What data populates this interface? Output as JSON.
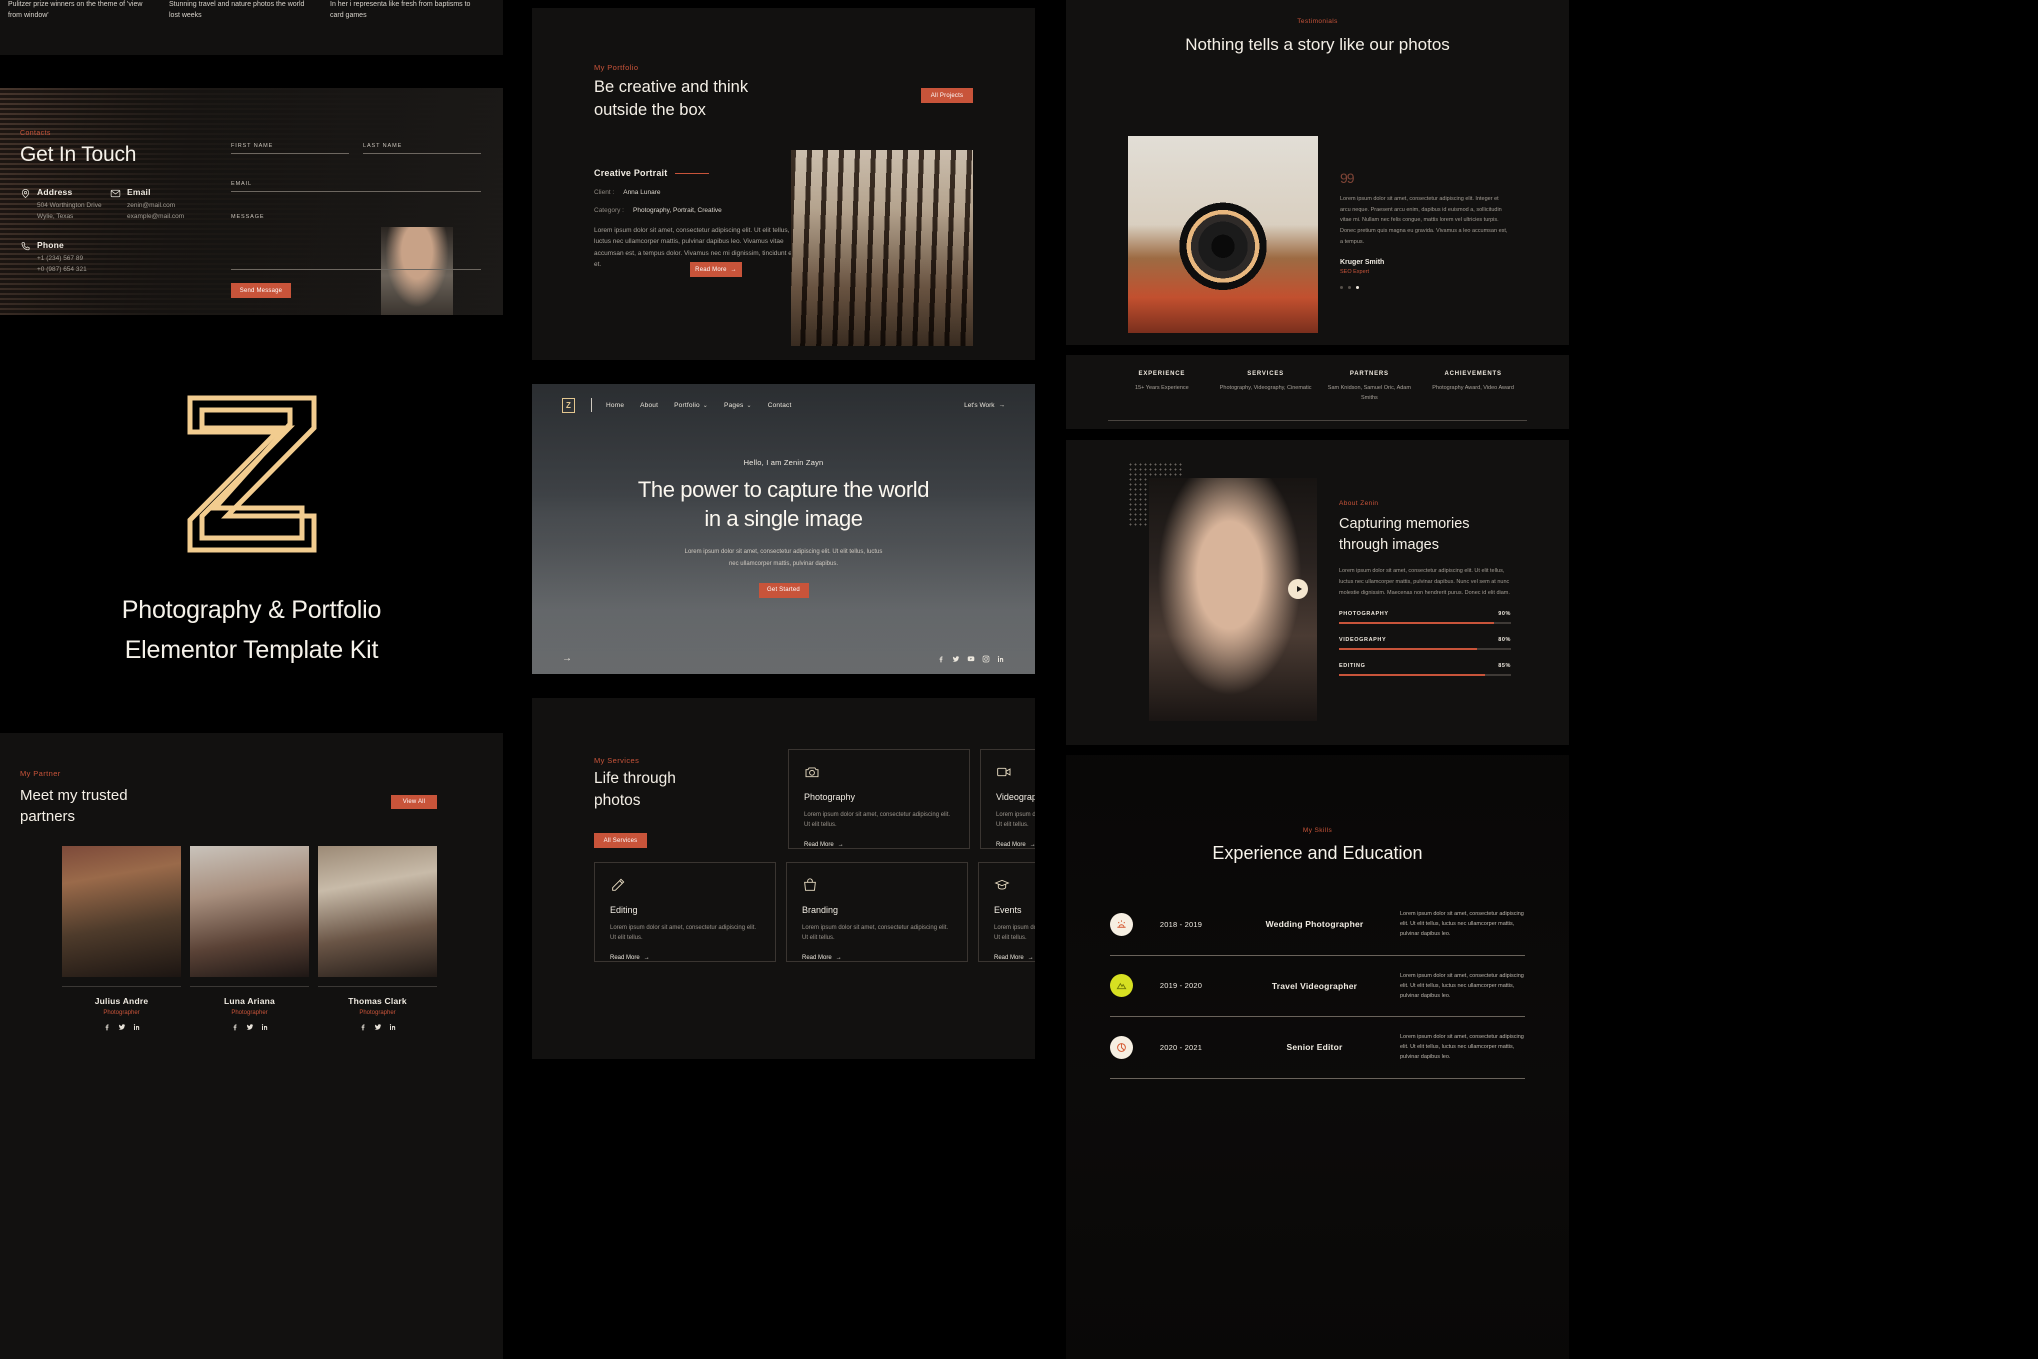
{
  "brand": {
    "logo_letter": "Z",
    "title_line1": "Photography & Portfolio",
    "title_line2": "Elementor Template Kit",
    "accent_gold": "#f2cc8f",
    "accent_red": "#c8543a",
    "panel_bg": "#121110"
  },
  "strip_top": {
    "columns": [
      "Pulitzer prize winners on the theme of 'view from window'",
      "Stunning travel and nature photos the world lost weeks",
      "In her i representa like fresh from baptisms to card games"
    ]
  },
  "contact": {
    "eyebrow": "Contacts",
    "heading": "Get In Touch",
    "blocks": [
      {
        "icon": "map-pin-icon",
        "title": "Address",
        "value": "504 Worthington Drive\nWylie, Texas"
      },
      {
        "icon": "envelope-icon",
        "title": "Email",
        "value": "zenin@mail.com\nexample@mail.com"
      },
      {
        "icon": "phone-icon",
        "title": "Phone",
        "value": "+1 (234) 567 89\n+0 (987) 654 321"
      }
    ],
    "fields": [
      {
        "label": "FIRST NAME",
        "value": ""
      },
      {
        "label": "LAST NAME",
        "value": ""
      },
      {
        "label": "EMAIL",
        "value": ""
      },
      {
        "label": "MESSAGE",
        "value": ""
      }
    ],
    "submit_label": "Send Message"
  },
  "partners": {
    "eyebrow": "My Partner",
    "heading_line1": "Meet my trusted",
    "heading_line2": "partners",
    "view_all_label": "View All",
    "cards": [
      {
        "name": "Julius Andre",
        "role": "Photographer",
        "socials": [
          "facebook-icon",
          "twitter-icon",
          "linkedin-icon"
        ]
      },
      {
        "name": "Luna Ariana",
        "role": "Photographer",
        "socials": [
          "facebook-icon",
          "twitter-icon",
          "linkedin-icon"
        ]
      },
      {
        "name": "Thomas Clark",
        "role": "Photographer",
        "socials": [
          "facebook-icon",
          "twitter-icon",
          "linkedin-icon"
        ]
      }
    ]
  },
  "portfolio": {
    "eyebrow": "My Portfolio",
    "heading_line1": "Be creative and think",
    "heading_line2": "outside the box",
    "all_projects_label": "All Projects",
    "project": {
      "title": "Creative Portrait",
      "client_key": "Client :",
      "client_value": "Anna Lunare",
      "category_key": "Category :",
      "category_value": "Photography, Portrait, Creative",
      "description": "Lorem ipsum dolor sit amet, consectetur adipiscing elit. Ut elit tellus, luctus nec ullamcorper mattis, pulvinar dapibus leo. Vivamus vitae accumsan est, a tempus dolor. Vivamus nec mi dignissim, tincidunt eros et.",
      "read_more_label": "Read More"
    }
  },
  "hero": {
    "logo_letter": "Z",
    "nav": [
      {
        "label": "Home",
        "has_caret": false
      },
      {
        "label": "About",
        "has_caret": false
      },
      {
        "label": "Portfolio",
        "has_caret": true
      },
      {
        "label": "Pages",
        "has_caret": true
      },
      {
        "label": "Contact",
        "has_caret": false
      }
    ],
    "cta_label": "Let's Work",
    "hello": "Hello, I am Zenin Zayn",
    "title_line1": "The power to capture the world",
    "title_line2": "in a single image",
    "subtitle_line1": "Lorem ipsum dolor sit amet, consectetur adipiscing elit. Ut elit tellus, luctus",
    "subtitle_line2": "nec ullamcorper mattis, pulvinar dapibus.",
    "button_label": "Get Started",
    "socials": [
      "facebook-icon",
      "twitter-icon",
      "youtube-icon",
      "instagram-icon",
      "linkedin-icon"
    ]
  },
  "services": {
    "eyebrow": "My Services",
    "heading_line1": "Life through",
    "heading_line2": "photos",
    "all_services_label": "All Services",
    "read_more_label": "Read More",
    "items": [
      {
        "icon": "camera-icon",
        "title": "Photography",
        "desc": "Lorem ipsum dolor sit amet, consectetur adipiscing elit. Ut elit tellus."
      },
      {
        "icon": "video-icon",
        "title": "Videography",
        "desc": "Lorem ipsum dolor sit amet, consectetur adipiscing elit. Ut elit tellus."
      },
      {
        "icon": "pencil-icon",
        "title": "Editing",
        "desc": "Lorem ipsum dolor sit amet, consectetur adipiscing elit. Ut elit tellus."
      },
      {
        "icon": "bag-icon",
        "title": "Branding",
        "desc": "Lorem ipsum dolor sit amet, consectetur adipiscing elit. Ut elit tellus."
      },
      {
        "icon": "graduation-icon",
        "title": "Events",
        "desc": "Lorem ipsum dolor sit amet, consectetur adipiscing elit. Ut elit tellus."
      }
    ]
  },
  "testimonials": {
    "eyebrow": "Testimonials",
    "heading_line1": "Nothing tells a story like our",
    "heading_line2": "photos",
    "quote_mark": "99",
    "quote": "Lorem ipsum dolor sit amet, consectetur adipiscing elit. Integer et arcu neque. Praesent arcu enim, dapibus id euismod a, sollicitudin vitae mi. Nullam nec felis congue, mattis lorem vel ultricies turpis. Donec pretium quis magna eu gravida. Vivamus a leo accumsan est, a tempus.",
    "author": "Kruger Smith",
    "author_role": "SEO Expert",
    "dots": 3,
    "active_dot": 3
  },
  "stats": {
    "cells": [
      {
        "label": "EXPERIENCE",
        "value": "15+ Years Experience"
      },
      {
        "label": "SERVICES",
        "value": "Photography, Videography, Cinematic"
      },
      {
        "label": "PARTNERS",
        "value": "Sam Knidson, Samuel Oric, Adam Smiths"
      },
      {
        "label": "ACHIEVEMENTS",
        "value": "Photography Award, Video Award"
      }
    ]
  },
  "about": {
    "eyebrow": "About Zenin",
    "heading_line1": "Capturing memories",
    "heading_line2": "through images",
    "description": "Lorem ipsum dolor sit amet, consectetur adipiscing elit. Ut elit tellus, luctus nec ullamcorper mattis, pulvinar dapibus. Nunc vel sem at nunc molestie dignissim. Maecenas non hendrerit purus. Donec id elit diam.",
    "play_label": "play-button",
    "skills": [
      {
        "label": "PHOTOGRAPHY",
        "value": "90%",
        "pct": 90
      },
      {
        "label": "VIDEOGRAPHY",
        "value": "80%",
        "pct": 80
      },
      {
        "label": "EDITING",
        "value": "85%",
        "pct": 85
      }
    ]
  },
  "experience": {
    "eyebrow": "My Skills",
    "heading": "Experience and Education",
    "rows": [
      {
        "icon": "sunrise-icon",
        "bubble": "b-cream",
        "years": "2018 - 2019",
        "role": "Wedding Photographer",
        "desc": "Lorem ipsum dolor sit amet, consectetur adipiscing elit. Ut elit tellus, luctus nec ullamcorper mattis, pulvinar dapibus leo."
      },
      {
        "icon": "mountain-icon",
        "bubble": "b-lime",
        "years": "2019 - 2020",
        "role": "Travel Videographer",
        "desc": "Lorem ipsum dolor sit amet, consectetur adipiscing elit. Ut elit tellus, luctus nec ullamcorper mattis, pulvinar dapibus leo."
      },
      {
        "icon": "aperture-icon",
        "bubble": "b-white",
        "years": "2020 - 2021",
        "role": "Senior Editor",
        "desc": "Lorem ipsum dolor sit amet, consectetur adipiscing elit. Ut elit tellus, luctus nec ullamcorper mattis, pulvinar dapibus leo."
      }
    ]
  }
}
